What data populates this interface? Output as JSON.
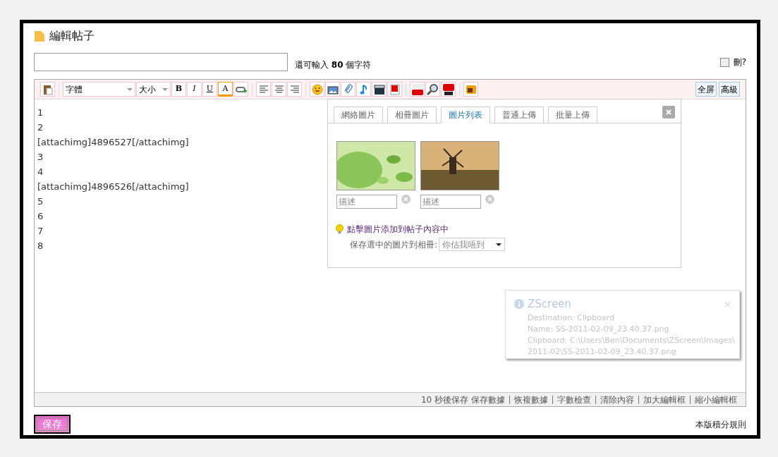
{
  "title": "編輯帖子",
  "subject": {
    "counter": "還可輸入 **80** 個字符"
  },
  "delete_option": {
    "label": "刪?",
    "checked": false
  },
  "toolbar": {
    "font": "字體",
    "size": "大小",
    "format": [
      {
        "kind": "bold",
        "label": "B"
      },
      {
        "kind": "italic",
        "label": "I"
      },
      {
        "kind": "underline",
        "label": "U"
      },
      {
        "kind": "color",
        "label": "A"
      }
    ],
    "fullscreen": "全屏",
    "advanced": "高級"
  },
  "editor_lines": [
    "1",
    "2",
    "[attachimg]4896527[/attachimg]",
    "3",
    "4",
    "[attachimg]4896526[/attachimg]",
    "5",
    "6",
    "7",
    "8"
  ],
  "image_panel": {
    "tabs": [
      {
        "label": "網絡圖片",
        "selected": false
      },
      {
        "label": "相冊圖片",
        "selected": false
      },
      {
        "label": "圖片列表",
        "selected": true
      },
      {
        "label": "普通上傳",
        "selected": false
      },
      {
        "label": "批量上傳",
        "selected": false
      }
    ],
    "images": [
      {
        "kind": "leaves",
        "placeholder": "描述"
      },
      {
        "kind": "windmill",
        "placeholder": "描述"
      }
    ],
    "hint": "點擊圖片添加到帖子內容中",
    "album_label": "保存選中的圖片到相冊:",
    "album_value": "你估我唔到"
  },
  "status_bar": {
    "autosave": "10 秒後保存",
    "links": [
      "保存數據",
      "恢複數據",
      "字數檢查",
      "清除內容",
      "加大編輯框",
      "縮小編輯框"
    ]
  },
  "save_button": "保存",
  "rules_link": "本版積分規則",
  "notification": {
    "title": "ZScreen",
    "lines": [
      "Destination: Clipboard",
      "Name: SS-2011-02-09_23.40.37.png",
      "Clipboard: C:\\Users\\Ben\\Documents\\ZScreen\\Images\\",
      "2011-02\\SS-2011-02-09_23.40.37.png"
    ]
  }
}
